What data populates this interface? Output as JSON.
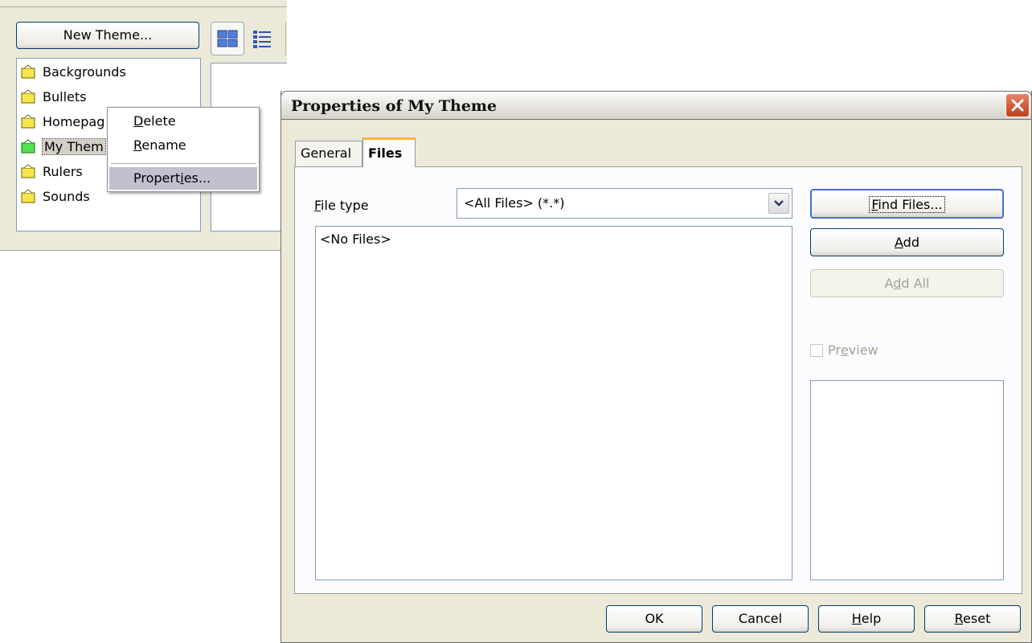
{
  "gallery": {
    "new_theme_label": "New Theme...",
    "themes": [
      {
        "label": "Backgrounds"
      },
      {
        "label": "Bullets"
      },
      {
        "label": "Homepag"
      },
      {
        "label": "My Them"
      },
      {
        "label": "Rulers"
      },
      {
        "label": "Sounds"
      }
    ]
  },
  "context_menu": {
    "delete": {
      "accel": "D",
      "rest": "elete"
    },
    "rename": {
      "accel": "R",
      "rest": "ename"
    },
    "properties": {
      "pre": "Propert",
      "accel": "i",
      "post": "es..."
    }
  },
  "dialog": {
    "title": "Properties of My Theme",
    "tabs": {
      "general": "General",
      "files": "Files"
    },
    "file_type": {
      "accel": "F",
      "rest": "ile type",
      "value": "<All Files> (*.*)"
    },
    "file_list_empty": "<No Files>",
    "find_files": {
      "accel": "F",
      "rest": "ind Files..."
    },
    "add": {
      "accel": "A",
      "rest": "dd"
    },
    "add_all": {
      "pre": "A",
      "accel": "d",
      "post": "d All"
    },
    "preview": {
      "pre": "Pr",
      "accel": "e",
      "post": "view"
    },
    "buttons": {
      "ok": "OK",
      "cancel": "Cancel",
      "help": {
        "accel": "H",
        "rest": "elp"
      },
      "reset": {
        "accel": "R",
        "rest": "eset"
      }
    }
  }
}
